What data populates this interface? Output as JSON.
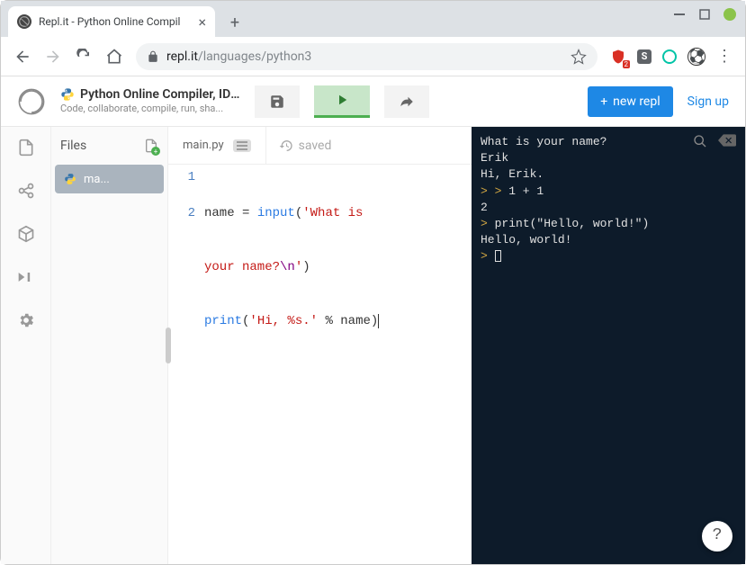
{
  "browser": {
    "tab_title": "Repl.it - Python Online Compil",
    "url_host": "repl.it",
    "url_path": "/languages/python3",
    "ext_badge": "2",
    "ext_s_label": "S"
  },
  "header": {
    "title": "Python Online Compiler, IDE,...",
    "subtitle": "Code, collaborate, compile, run, sha...",
    "new_repl_label": "new repl",
    "signup_label": "Sign up"
  },
  "sidebar": {
    "files_label": "Files",
    "files": [
      {
        "name": "ma..."
      }
    ]
  },
  "editor": {
    "tab_label": "main.py",
    "saved_label": "saved",
    "code": {
      "line1": {
        "lhs": "name",
        "op": " = ",
        "func": "input",
        "paren_open": "(",
        "str1": "'What is ",
        "str2": "your name?",
        "esc": "\\n",
        "str_close": "'",
        "paren_close": ")"
      },
      "line2": {
        "func": "print",
        "paren_open": "(",
        "str1": "'Hi, %s.'",
        "op": " % ",
        "rhs": "name",
        "paren_close": ")"
      }
    }
  },
  "console": {
    "lines": [
      {
        "type": "out",
        "text": "What is your name?"
      },
      {
        "type": "out",
        "text": "Erik"
      },
      {
        "type": "out",
        "text": "Hi, Erik."
      },
      {
        "type": "in2",
        "text": "1 + 1"
      },
      {
        "type": "out",
        "text": "2"
      },
      {
        "type": "in",
        "text": "print(\"Hello, world!\")"
      },
      {
        "type": "out",
        "text": "Hello, world!"
      }
    ],
    "help_label": "?"
  }
}
